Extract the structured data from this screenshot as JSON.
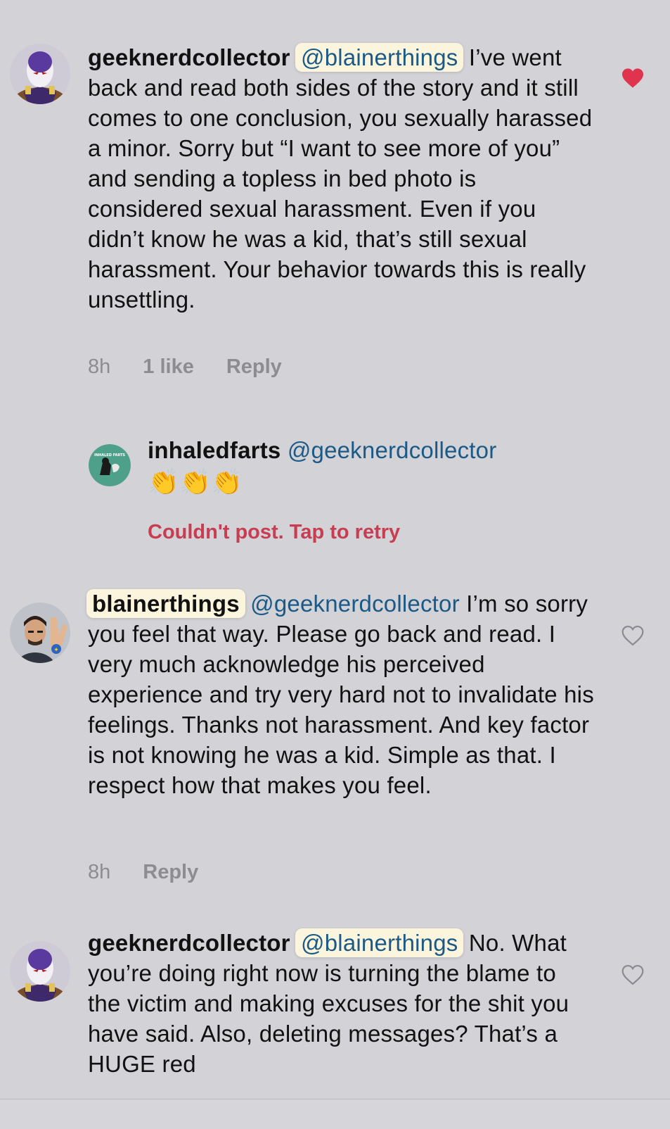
{
  "comments": [
    {
      "username": "geeknerdcollector",
      "mention": "@blainerthings",
      "text": "I’ve went back and read both sides of the story and it still comes to one conclusion, you sexually harassed a minor. Sorry but “I want to see more of you” and sending a topless in bed photo is considered sexual harassment. Even if you didn’t know he was a kid, that’s still sexual harassment. Your behavior towards this is really unsettling.",
      "time": "8h",
      "likes": "1 like",
      "reply_label": "Reply",
      "liked": true
    },
    {
      "username": "inhaledfarts",
      "mention": "@geeknerdcollector",
      "text": "👏👏👏",
      "error": "Couldn't post. Tap to retry",
      "avatar_text": "INHALED FARTS"
    },
    {
      "username": "blainerthings",
      "mention": "@geeknerdcollector",
      "text": "I’m so sorry you feel that way. Please go back and read. I very much acknowledge his perceived experience and try very hard not to invalidate his feelings. Thanks not harassment. And key factor is not knowing he was a kid. Simple as that. I respect how that makes you feel.",
      "time": "8h",
      "reply_label": "Reply",
      "liked": false
    },
    {
      "username": "geeknerdcollector",
      "mention": "@blainerthings",
      "text": "No. What you’re doing right now is turning the blame to the victim and making excuses for the shit you have said. Also, deleting messages? That’s a HUGE red",
      "liked": false
    }
  ],
  "colors": {
    "heart_liked": "#e0334d",
    "error": "#c73d51",
    "mention": "#1b5a86"
  },
  "icons": {
    "like": "heart-icon",
    "liked": "heart-filled-icon"
  }
}
